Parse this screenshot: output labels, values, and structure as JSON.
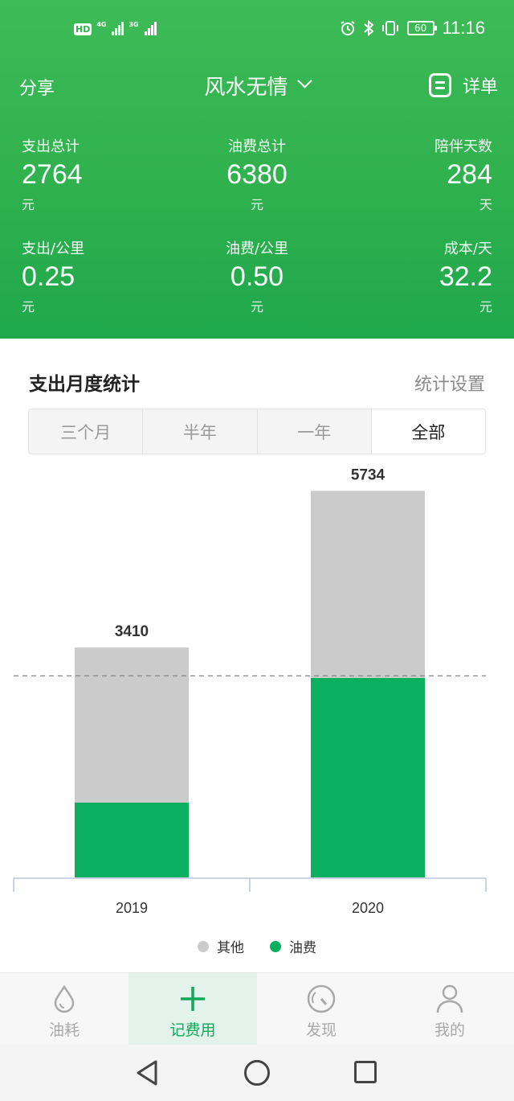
{
  "status_bar": {
    "hd": "HD",
    "net1": "4G",
    "net2": "3G",
    "battery": "60",
    "time": "11:16"
  },
  "header": {
    "share_label": "分享",
    "title": "风水无情",
    "detail_label": "详单"
  },
  "stats": [
    {
      "label": "支出总计",
      "value": "2764",
      "unit": "元"
    },
    {
      "label": "油费总计",
      "value": "6380",
      "unit": "元"
    },
    {
      "label": "陪伴天数",
      "value": "284",
      "unit": "天"
    },
    {
      "label": "支出/公里",
      "value": "0.25",
      "unit": "元"
    },
    {
      "label": "油费/公里",
      "value": "0.50",
      "unit": "元"
    },
    {
      "label": "成本/天",
      "value": "32.2",
      "unit": "元"
    }
  ],
  "section": {
    "title": "支出月度统计",
    "settings_label": "统计设置"
  },
  "periods": {
    "items": [
      "三个月",
      "半年",
      "一年",
      "全部"
    ],
    "active": "全部"
  },
  "chart_data": {
    "type": "bar",
    "stacked": true,
    "categories": [
      "2019",
      "2020"
    ],
    "series": [
      {
        "name": "油费",
        "color": "#0aaf60",
        "values": [
          1110,
          2960
        ]
      },
      {
        "name": "其他",
        "color": "#cbcbcb",
        "values": [
          2300,
          2774
        ]
      }
    ],
    "totals": [
      3410,
      5734
    ],
    "reference_line": 2990,
    "ylim": [
      0,
      6000
    ],
    "legend": [
      "其他",
      "油费"
    ],
    "legend_position": "bottom",
    "grid": false
  },
  "tabs": [
    {
      "label": "油耗",
      "icon": "drop-icon",
      "active": false
    },
    {
      "label": "记费用",
      "icon": "plus-icon",
      "active": true
    },
    {
      "label": "发现",
      "icon": "gauge-icon",
      "active": false
    },
    {
      "label": "我的",
      "icon": "person-icon",
      "active": false
    }
  ],
  "colors": {
    "header_green": "#2fb14e",
    "accent_green": "#0aaf60",
    "other_gray": "#cbcbcb",
    "active_tab_bg": "#e3f3eb"
  }
}
